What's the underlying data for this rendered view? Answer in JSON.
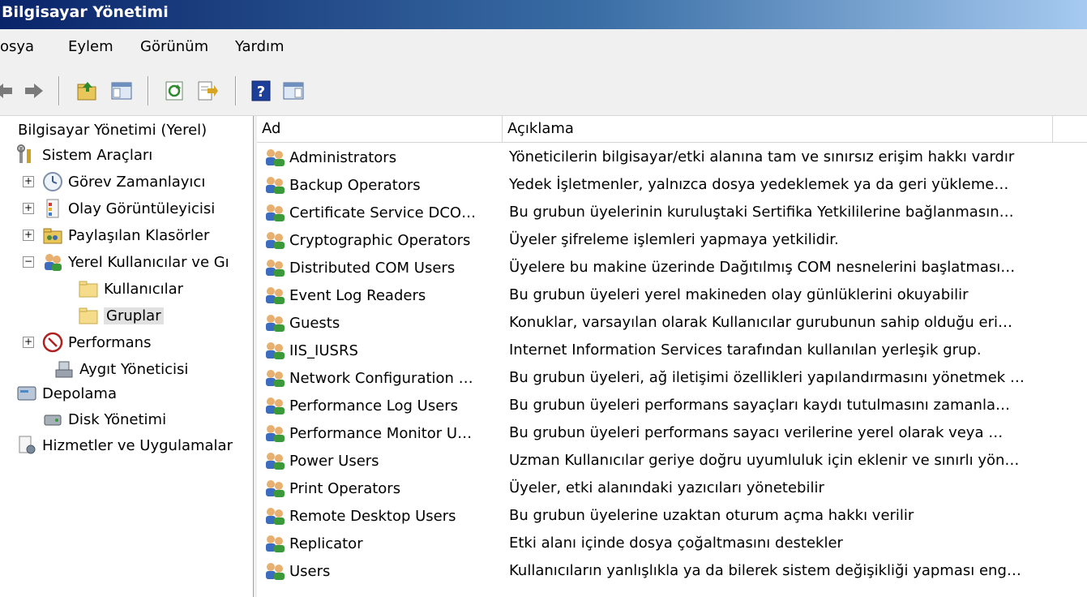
{
  "window": {
    "title": "Bilgisayar Yönetimi"
  },
  "menu": [
    "osya",
    "Eylem",
    "Görünüm",
    "Yardım"
  ],
  "toolbar_icons": [
    "back-arrow-icon",
    "forward-arrow-icon",
    "up-folder-icon",
    "show-hide-tree-icon",
    "refresh-icon",
    "export-list-icon",
    "help-icon",
    "show-action-pane-icon"
  ],
  "tree": {
    "root": "Bilgisayar Yönetimi (Yerel)",
    "system_tools": "Sistem Araçları",
    "task_scheduler": "Görev Zamanlayıcı",
    "event_viewer": "Olay Görüntüleyicisi",
    "shared_folders": "Paylaşılan Klasörler",
    "local_users_groups": "Yerel Kullanıcılar ve Gı",
    "users": "Kullanıcılar",
    "groups": "Gruplar",
    "performance": "Performans",
    "device_manager": "Aygıt Yöneticisi",
    "storage": "Depolama",
    "disk_management": "Disk Yönetimi",
    "services_apps": "Hizmetler ve Uygulamalar"
  },
  "columns": {
    "name": "Ad",
    "description": "Açıklama"
  },
  "groups": [
    {
      "name": "Administrators",
      "description": "Yöneticilerin bilgisayar/etki alanına tam ve sınırsız erişim hakkı vardır"
    },
    {
      "name": "Backup Operators",
      "description": "Yedek İşletmenler, yalnızca dosya yedeklemek ya da geri yükleme…"
    },
    {
      "name": "Certificate Service DCO…",
      "description": "Bu grubun üyelerinin kuruluştaki Sertifika Yetkililerine bağlanmasın…"
    },
    {
      "name": "Cryptographic Operators",
      "description": "Üyeler şifreleme işlemleri yapmaya yetkilidir."
    },
    {
      "name": "Distributed COM Users",
      "description": "Üyelere bu makine üzerinde Dağıtılmış COM nesnelerini başlatması…"
    },
    {
      "name": "Event Log Readers",
      "description": "Bu grubun üyeleri yerel makineden olay günlüklerini okuyabilir"
    },
    {
      "name": "Guests",
      "description": "Konuklar, varsayılan olarak Kullanıcılar gurubunun sahip olduğu eri…"
    },
    {
      "name": "IIS_IUSRS",
      "description": "Internet Information Services tarafından kullanılan yerleşik grup."
    },
    {
      "name": "Network Configuration …",
      "description": "Bu grubun üyeleri, ağ iletişimi özellikleri yapılandırmasını yönetmek …"
    },
    {
      "name": "Performance Log Users",
      "description": "Bu grubun üyeleri performans sayaçları kaydı tutulmasını zamanla…"
    },
    {
      "name": "Performance Monitor U…",
      "description": "Bu grubun üyeleri performans sayacı verilerine yerel olarak veya …"
    },
    {
      "name": "Power Users",
      "description": "Uzman Kullanıcılar geriye doğru uyumluluk için eklenir ve sınırlı yön…"
    },
    {
      "name": "Print Operators",
      "description": "Üyeler, etki alanındaki yazıcıları yönetebilir"
    },
    {
      "name": "Remote Desktop Users",
      "description": "Bu grubun üyelerine uzaktan oturum açma hakkı verilir"
    },
    {
      "name": "Replicator",
      "description": "Etki alanı içinde dosya çoğaltmasını destekler"
    },
    {
      "name": "Users",
      "description": "Kullanıcıların yanlışlıkla ya da bilerek sistem değişikliği yapması eng…"
    }
  ]
}
